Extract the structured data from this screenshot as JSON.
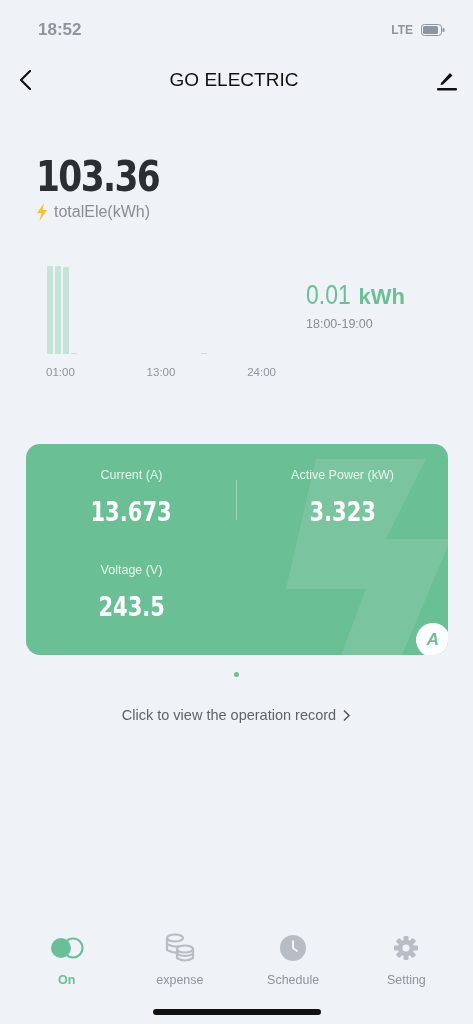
{
  "status_bar": {
    "time": "18:52",
    "network": "LTE"
  },
  "header": {
    "title": "GO ELECTRIC"
  },
  "total": {
    "value": "103.36",
    "label": "totalEle(kWh)"
  },
  "usage_chart": {
    "x_labels": [
      "01:00",
      "13:00",
      "24:00"
    ],
    "reading": "0.01",
    "unit": "kWh",
    "range": "18:00-19:00"
  },
  "metrics": [
    {
      "label": "Current (A)",
      "value": "13.673"
    },
    {
      "label": "Active Power (kW)",
      "value": "3.323"
    },
    {
      "label": "Voltage (V)",
      "value": "243.5"
    }
  ],
  "card_badge": "A",
  "pager": [
    {
      "selected": true
    }
  ],
  "record_link": "Click to view the operation record",
  "tabs": [
    {
      "label": "On",
      "kind": "toggle",
      "selected": true
    },
    {
      "label": "expense",
      "kind": "coins",
      "selected": false
    },
    {
      "label": "Schedule",
      "kind": "clock",
      "selected": false
    },
    {
      "label": "Setting",
      "kind": "gear",
      "selected": false
    }
  ]
}
